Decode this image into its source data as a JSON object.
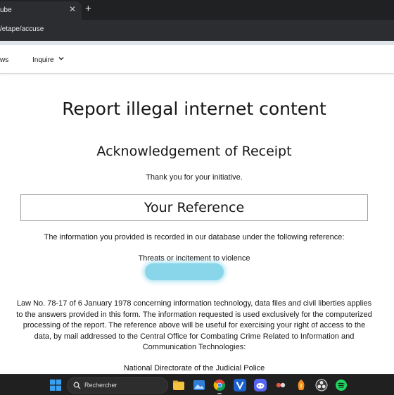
{
  "browser": {
    "tab_title": "ube",
    "tab_close": "✕",
    "new_tab": "+",
    "url": "/etape/accuse"
  },
  "site_nav": {
    "news_label": "ws",
    "inquire_label": "Inquire"
  },
  "page": {
    "title": "Report illegal internet content",
    "subtitle": "Acknowledgement of Receipt",
    "thanks": "Thank you for your initiative.",
    "reference_heading": "Your Reference",
    "info_text": "The information you provided is recorded in our database under the following reference:",
    "category": "Threats or incitement to violence",
    "law_text": "Law No. 78-17 of 6 January 1978 concerning information technology, data files and civil liberties applies to the answers provided in this form. The information requested is used exclusively for the computerized processing of the report. The reference above will be useful for exercising your right of access to the data, by mail addressed to the Central Office for Combating Crime Related to Information and Communication Technologies:",
    "directorate": "National Directorate of the Judicial Police"
  },
  "taskbar": {
    "search_placeholder": "Rechercher",
    "icons": [
      "windows-icon",
      "file-explorer-icon",
      "photos-icon",
      "chrome-icon",
      "vegas-icon",
      "discord-icon",
      "app-icon",
      "fl-studio-icon",
      "obs-icon",
      "spotify-icon"
    ]
  },
  "colors": {
    "chrome_dark": "#1f2123",
    "redaction": "#7fd3ea",
    "text": "#161616"
  }
}
